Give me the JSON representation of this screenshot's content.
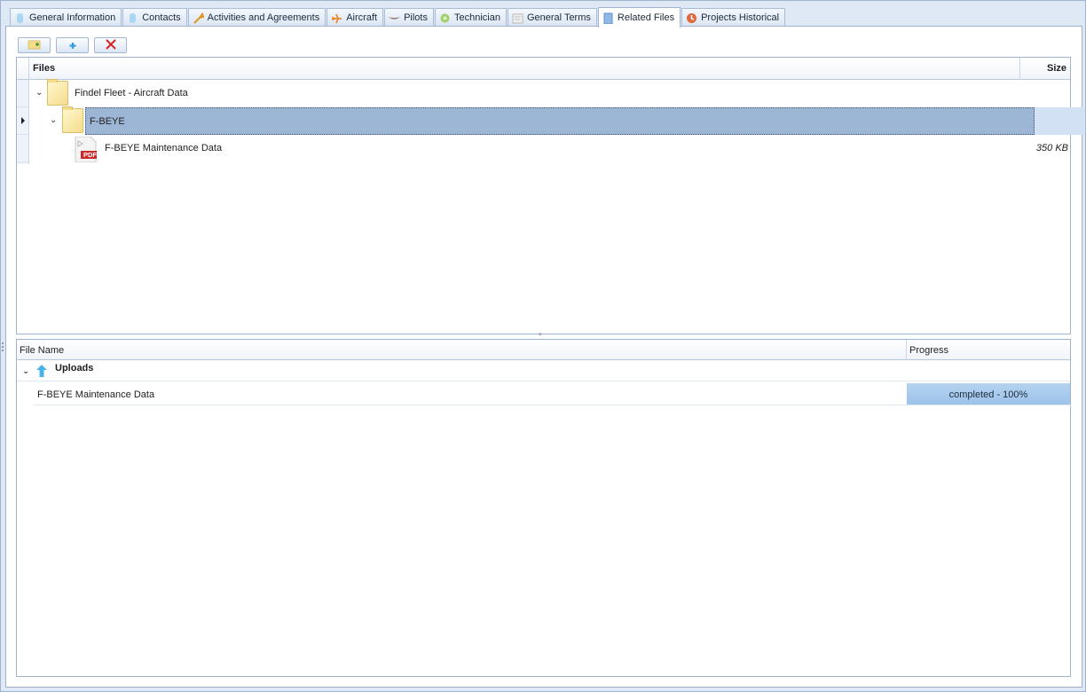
{
  "tabs": [
    {
      "label": "General Information",
      "icon": "general-info-icon",
      "active": false
    },
    {
      "label": "Contacts",
      "icon": "contacts-icon",
      "active": false
    },
    {
      "label": "Activities and Agreements",
      "icon": "wrench-icon",
      "active": false
    },
    {
      "label": "Aircraft",
      "icon": "aircraft-icon",
      "active": false
    },
    {
      "label": "Pilots",
      "icon": "pilot-wings-icon",
      "active": false
    },
    {
      "label": "Technician",
      "icon": "technician-icon",
      "active": false
    },
    {
      "label": "General Terms",
      "icon": "terms-icon",
      "active": false
    },
    {
      "label": "Related Files",
      "icon": "file-icon",
      "active": true
    },
    {
      "label": "Projects Historical",
      "icon": "history-icon",
      "active": false
    }
  ],
  "toolbar": {
    "add_folder_icon": "add-folder-icon",
    "add_file_icon": "add-file-icon",
    "delete_icon": "delete-icon"
  },
  "files_grid": {
    "col_files": "Files",
    "col_size": "Size",
    "rows": [
      {
        "label": "Findel Fleet - Aircraft Data",
        "type": "folder",
        "size": ""
      },
      {
        "label": "F-BEYE",
        "type": "folder",
        "size": ""
      },
      {
        "label": "F-BEYE Maintenance Data",
        "type": "pdf",
        "size": "350 KB",
        "pdf_badge": "PDF"
      }
    ]
  },
  "uploads_grid": {
    "col_name": "File Name",
    "col_progress": "Progress",
    "group_label": "Uploads",
    "items": [
      {
        "name": "F-BEYE Maintenance Data",
        "progress_text": "completed - 100%",
        "progress": 1.0
      }
    ]
  },
  "colors": {
    "selection": "#9eb6d6",
    "progress_fill": "#9cc3ea",
    "delete_red": "#d42020"
  }
}
